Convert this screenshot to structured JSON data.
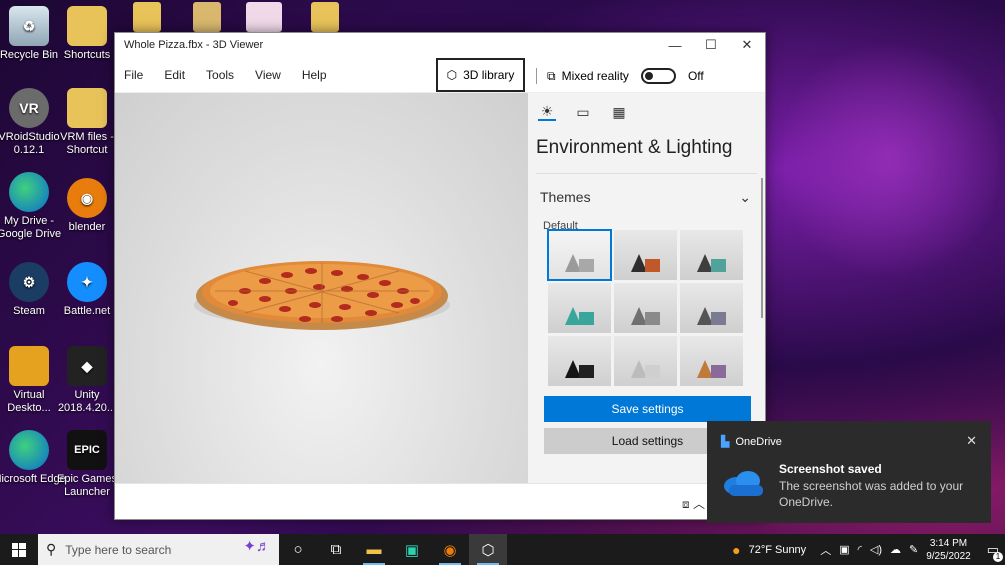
{
  "desktop": {
    "icons": [
      {
        "label": "Recycle Bin"
      },
      {
        "label": "Shortcuts"
      },
      {
        "label": "VRoidStudio 0.12.1",
        "glyph": "VR"
      },
      {
        "label": "VRM files - Shortcut"
      },
      {
        "label": "My Drive - Google Drive"
      },
      {
        "label": "blender"
      },
      {
        "label": "Steam"
      },
      {
        "label": "Battle.net"
      },
      {
        "label": "Virtual Deskto..."
      },
      {
        "label": "Unity 2018.4.20..."
      },
      {
        "label": "Microsoft Edge"
      },
      {
        "label": "Epic Games Launcher",
        "glyph": "EPIC"
      }
    ]
  },
  "window": {
    "title": "Whole Pizza.fbx - 3D Viewer",
    "menu": [
      "File",
      "Edit",
      "Tools",
      "View",
      "Help"
    ],
    "library_label": "3D library",
    "mixed_reality_label": "Mixed reality",
    "mixed_reality_state": "Off",
    "panel": {
      "heading": "Environment & Lighting",
      "section": "Themes",
      "default_label": "Default",
      "save_label": "Save settings",
      "load_label": "Load settings",
      "themes": [
        {
          "cone": "#9a9a9a",
          "box": "#a8a8a8",
          "selected": true
        },
        {
          "cone": "#2e2e2e",
          "box": "#c0582a"
        },
        {
          "cone": "#3e3e3e",
          "box": "#4fa39a"
        },
        {
          "cone": "#3aa59a",
          "box": "#3aa59a"
        },
        {
          "cone": "#707070",
          "box": "#8a8a8a"
        },
        {
          "cone": "#555",
          "box": "#7a7a90"
        },
        {
          "cone": "#151515",
          "box": "#202020"
        },
        {
          "cone": "#bcbcbc",
          "box": "#cfcfcf"
        },
        {
          "cone": "#c07a3a",
          "box": "#8a6a9a"
        }
      ]
    }
  },
  "toast": {
    "app": "OneDrive",
    "title": "Screenshot saved",
    "body": "The screenshot was added to your OneDrive."
  },
  "taskbar": {
    "search_placeholder": "Type here to search",
    "weather": "72°F  Sunny",
    "time": "3:14 PM",
    "date": "9/25/2022",
    "notif_count": "1"
  }
}
